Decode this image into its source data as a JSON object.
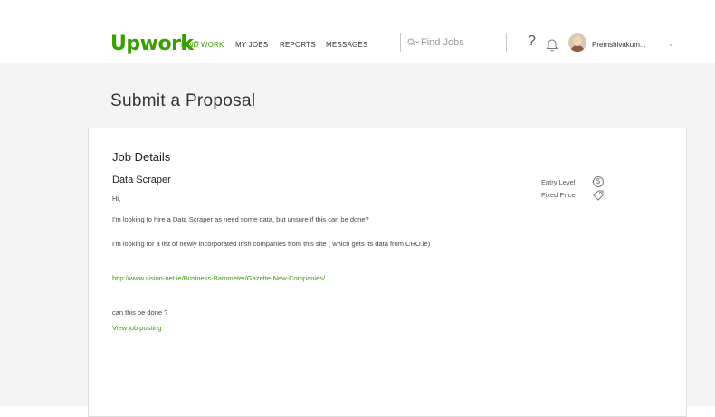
{
  "header": {
    "logo": {
      "up": "Up",
      "work": "work",
      "tm": "™"
    },
    "nav": [
      {
        "label": "FIND WORK",
        "active": true
      },
      {
        "label": "MY JOBS",
        "active": false
      },
      {
        "label": "REPORTS",
        "active": false
      },
      {
        "label": "MESSAGES",
        "active": false
      }
    ],
    "search": {
      "icon": "search-icon",
      "dropdown": "⌄",
      "placeholder": "Find Jobs"
    },
    "help_label": "?",
    "username": "Premshivakum...",
    "user_caret": "⌄"
  },
  "page": {
    "title": "Submit a Proposal"
  },
  "job": {
    "section_title": "Job Details",
    "title": "Data Scraper",
    "greeting": "Hi,",
    "paragraph1": "I'm looking to hire a Data Scraper as need some data, but unsure if this can be done?",
    "paragraph2": "I'm looking for a list of newly incorporated Irish companies from this site ( which gets its data from CRO.ie)",
    "url": "http://www.vision-net.ie/Business-Barometer/Gazette-New-Companies/",
    "question": "can this be done ?",
    "view_posting_label": "View job posting",
    "level": "Entry Level",
    "level_icon": "$",
    "price_type": "Fixed Price",
    "price_icon": "tag-icon"
  },
  "colors": {
    "brand": "#37a000",
    "page_bg": "#f4f4f4",
    "card_border": "#dedede"
  }
}
